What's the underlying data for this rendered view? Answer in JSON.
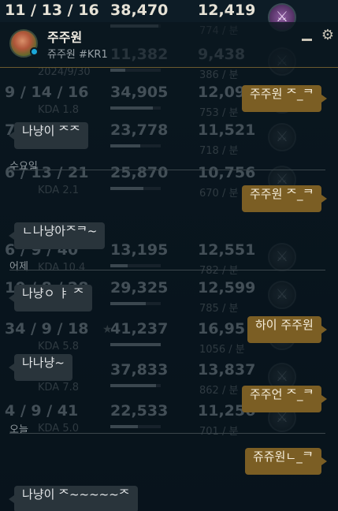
{
  "stats_rows": [
    {
      "kda": "11 / 13 / 16",
      "kda_ratio": "",
      "gold": "38,470",
      "gold_fill": 0.95,
      "damage": "12,419",
      "rate": "774 / 분",
      "emblem": "lit"
    },
    {
      "kda": "",
      "kda_ratio": "2024/9/30",
      "gold": "11,382",
      "gold_fill": 0.3,
      "damage": "9,438",
      "rate": "386 / 분",
      "emblem": "dim"
    },
    {
      "kda": "9 / 14 / 16",
      "kda_ratio": "KDA 1.8",
      "gold": "34,905",
      "gold_fill": 0.85,
      "damage": "12,091",
      "rate": "753 / 분",
      "emblem": "dim"
    },
    {
      "kda": "7",
      "kda_ratio": "",
      "gold": "23,778",
      "gold_fill": 0.6,
      "damage": "11,521",
      "rate": "718 / 분",
      "emblem": "dim"
    },
    {
      "kda": "6 / 13 / 21",
      "kda_ratio": "KDA 2.1",
      "gold": "25,870",
      "gold_fill": 0.65,
      "damage": "10,756",
      "rate": "670 / 분",
      "emblem": "dim"
    },
    {
      "kda": "6 / 9 / 40",
      "kda_ratio": "KDA 10.4",
      "gold": "13,195",
      "gold_fill": 0.35,
      "damage": "12,551",
      "rate": "782 / 분",
      "emblem": "dim"
    },
    {
      "kda": "10 / 8 / 28",
      "kda_ratio": "",
      "gold": "29,325",
      "gold_fill": 0.7,
      "damage": "12,599",
      "rate": "785 / 분",
      "emblem": "dim"
    },
    {
      "kda": "34 / 9 / 18",
      "kda_ratio": "KDA 5.8",
      "gold": "41,237",
      "gold_fill": 1.0,
      "damage": "16,95",
      "rate": "1056 / 분",
      "emblem": "dim",
      "star": true
    },
    {
      "kda": "",
      "kda_ratio": "KDA 7.8",
      "gold": "37,833",
      "gold_fill": 0.9,
      "damage": "13,837",
      "rate": "862 / 분",
      "emblem": "dim"
    },
    {
      "kda": "4 / 9 / 41",
      "kda_ratio": "KDA 5.0",
      "gold": "22,533",
      "gold_fill": 0.55,
      "damage": "11,256",
      "rate": "701 / 분",
      "emblem": "dim"
    }
  ],
  "chat": {
    "friend_name": "주주원",
    "friend_tag": "쥬주원 #KR1",
    "messages": [
      {
        "dir": "out",
        "text": "주주원 ᄌ_ᄏ"
      },
      {
        "dir": "in",
        "text": "나냥이 ᄌᄌ"
      },
      {
        "dir": "divider",
        "text": "수요일"
      },
      {
        "dir": "out",
        "text": "주주원 ᄌ_ᄏ"
      },
      {
        "dir": "in",
        "text": "ㄴ나냥아ᄌᄏ~"
      },
      {
        "dir": "divider",
        "text": "어제"
      },
      {
        "dir": "in",
        "text": "나냥ㅇ ㅑ ᄌ"
      },
      {
        "dir": "out",
        "text": "하이 주주원"
      },
      {
        "dir": "in",
        "text": "나나냥~"
      },
      {
        "dir": "out",
        "text": "주주언 ᄌ_ᄏ"
      },
      {
        "dir": "divider",
        "text": "오늘"
      },
      {
        "dir": "out",
        "text": "쥬쥬원ㄴ_ᄏ"
      },
      {
        "dir": "in",
        "text": "나냥이 ᄌ~~~~~ᄌ"
      }
    ]
  },
  "colors": {
    "outgoing_bubble": "#7b5e24",
    "incoming_bubble": "#29343b",
    "online": "#1aa7d9"
  },
  "icons": {
    "minimize": "minimize-icon",
    "settings": "gear-icon",
    "emblem": "role-emblem-icon"
  }
}
